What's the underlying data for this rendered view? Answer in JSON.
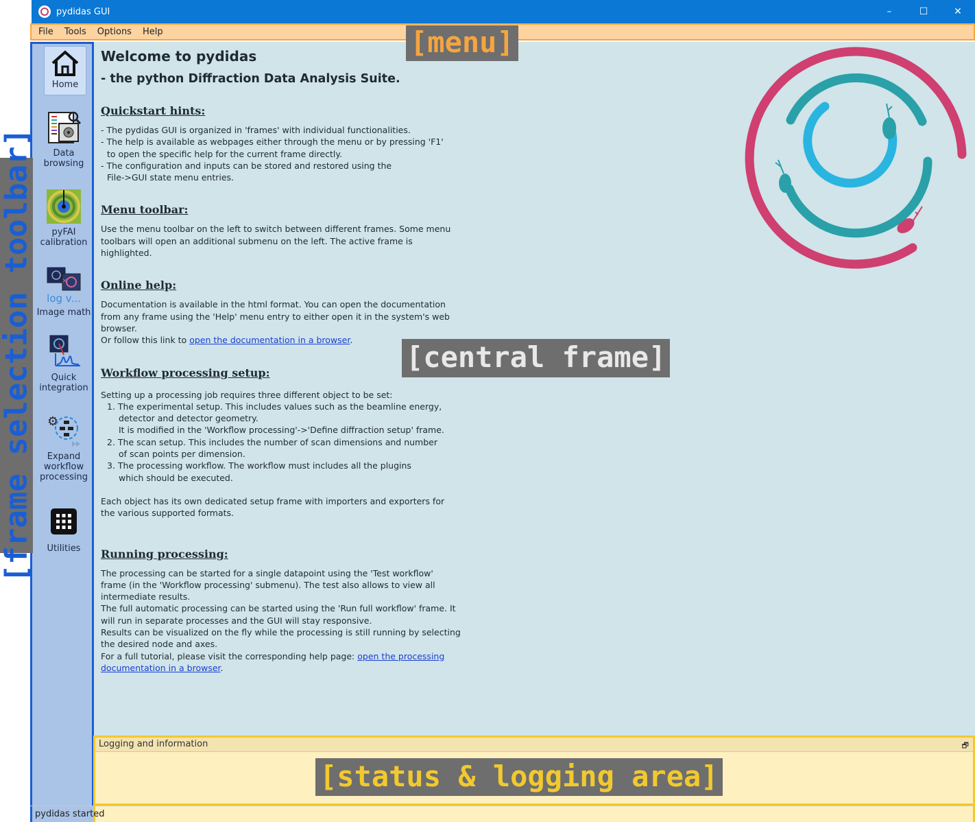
{
  "window": {
    "title": "pydidas GUI",
    "minimize": "–",
    "maximize": "☐",
    "close": "✕"
  },
  "menu": [
    "File",
    "Tools",
    "Options",
    "Help"
  ],
  "annotations": {
    "menu": "[menu]",
    "toolbar": "[frame selection toolbar]",
    "central": "[central frame]",
    "logging": "[status & logging area]"
  },
  "toolbar": [
    {
      "label": "Home",
      "icon": "home-icon"
    },
    {
      "label": "Data\nbrowsing",
      "icon": "data-browsing-icon"
    },
    {
      "label": "pyFAI\ncalibration",
      "icon": "pyfai-calibration-icon"
    },
    {
      "label": "Image math",
      "icon": "image-math-icon",
      "icon_text": "log v..."
    },
    {
      "label": "Quick\nintegration",
      "icon": "quick-integration-icon"
    },
    {
      "label": "Expand\nworkflow\nprocessing",
      "icon": "workflow-processing-icon"
    },
    {
      "label": "Utilities",
      "icon": "utilities-grid-icon"
    }
  ],
  "content": {
    "title": "Welcome to pydidas",
    "subtitle": "- the python Diffraction Data Analysis Suite.",
    "quickstart": {
      "heading": "Quickstart hints:",
      "lines": [
        "- The pydidas GUI is organized in 'frames' with individual functionalities.",
        "- The help is available as webpages either through the menu or by pressing 'F1'",
        "  to open the specific help for the current frame directly.",
        "- The configuration and inputs can be stored and restored using the",
        "  File->GUI state menu entries."
      ]
    },
    "menu_toolbar": {
      "heading": "Menu toolbar:",
      "lines": [
        "Use the menu toolbar on the left to switch between different frames. Some menu",
        "toolbars will open an additional submenu on the left. The active frame is",
        "highlighted."
      ]
    },
    "online_help": {
      "heading": "Online help:",
      "lines": [
        "Documentation is available in the html format. You can open the documentation",
        "from any frame using the 'Help' menu entry to either open it in the system's web",
        "browser."
      ],
      "link_prefix": "Or follow this link to ",
      "link_text": "open the documentation in a browser",
      "link_suffix": "."
    },
    "workflow_setup": {
      "heading": "Workflow processing setup:",
      "intro": "Setting up a processing job requires three different object to be set:",
      "items": [
        {
          "lead": "1. The experimental setup. This includes values such as the beamline energy,",
          "cont": [
            "detector and detector geometry.",
            "It is modified in the 'Workflow processing'->'Define diffraction setup' frame."
          ]
        },
        {
          "lead": "2. The scan setup. This includes the number of scan dimensions and number",
          "cont": [
            "of scan points per dimension."
          ]
        },
        {
          "lead": "3. The processing workflow. The workflow must includes all the plugins",
          "cont": [
            "which should be executed."
          ]
        }
      ],
      "outro": [
        "Each object has its own dedicated setup frame with importers and exporters for",
        "the various supported formats."
      ]
    },
    "running": {
      "heading": "Running processing:",
      "lines": [
        "The processing can be started for a single datapoint using the 'Test workflow'",
        "frame (in the 'Workflow processing' submenu). The test also allows to view all",
        "intermediate results.",
        "The full automatic processing can be started using the 'Run full workflow' frame. It",
        "will run in separate processes and the GUI will stay responsive.",
        "Results can be visualized on the fly while the processing is still running by selecting",
        "the desired node and axes."
      ],
      "link_prefix": "For a full tutorial, please visit the corresponding help page: ",
      "link_text_1": "open the processing",
      "link_text_2": "documentation in a browser",
      "link_suffix": "."
    }
  },
  "logging": {
    "header": "Logging and information",
    "float_icon": "🗗"
  },
  "status": {
    "message": "pydidas started"
  },
  "colors": {
    "accent": "#0a78d4",
    "toolbar": "#aac4e8",
    "central": "#d0e4ea",
    "logging": "#fff0c0",
    "menu": "#fdd3a0"
  }
}
